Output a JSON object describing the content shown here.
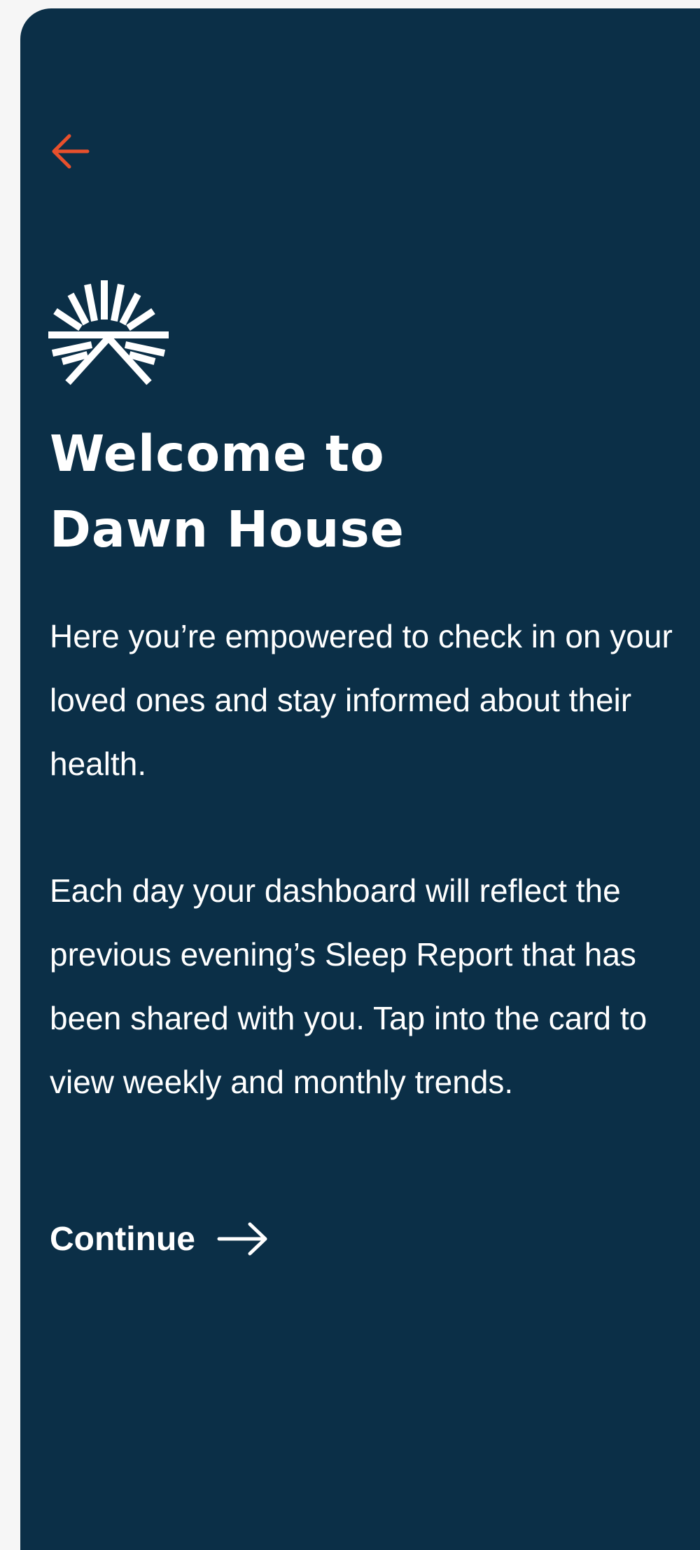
{
  "colors": {
    "background": "#0b2f47",
    "page": "#f6f6f6",
    "accent": "#e8502c",
    "text": "#ffffff"
  },
  "header": {
    "back_icon": "arrow-left-icon"
  },
  "brand": {
    "logo_icon": "sunrise-logo-icon"
  },
  "welcome": {
    "title_line1": "Welcome to",
    "title_line2": "Dawn House",
    "intro": "Here you’re empowered to check in on your loved ones and stay informed about their health.",
    "details": "Each day your dashboard will reflect the previous evening’s Sleep Report that has been shared with you.  Tap into the card to view weekly and monthly trends."
  },
  "actions": {
    "continue_label": "Continue",
    "continue_icon": "arrow-right-icon"
  }
}
